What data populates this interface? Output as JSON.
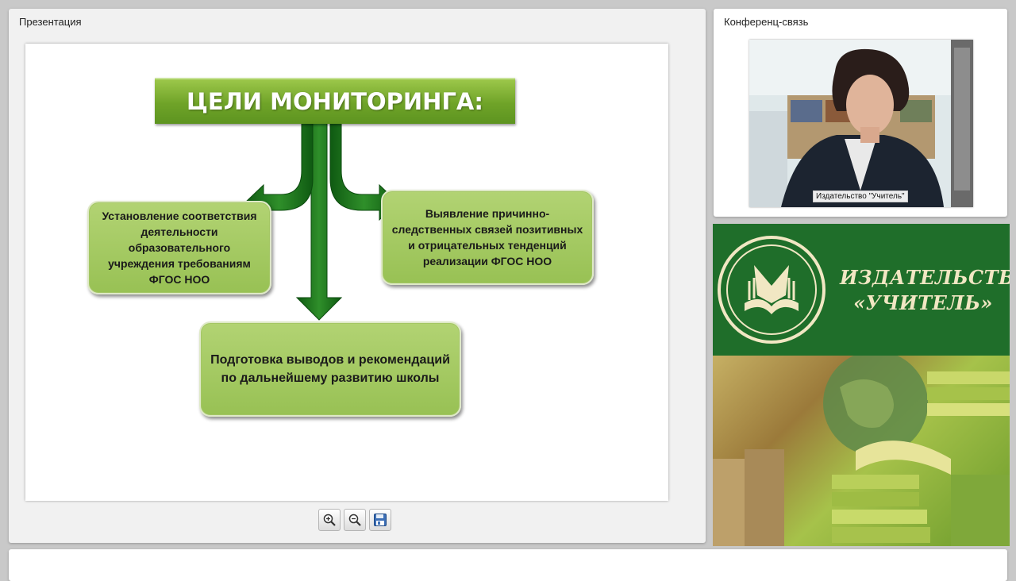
{
  "presentation": {
    "panel_title": "Презентация",
    "slide": {
      "heading": "ЦЕЛИ МОНИТОРИНГА:",
      "goals": [
        "Установление соответствия деятельности образовательного учреждения требованиям ФГОС НОО",
        "Выявление причинно-следственных связей позитивных и отрицательных тенденций реализации ФГОС НОО",
        "Подготовка выводов и рекомендаций по дальнейшему развитию школы"
      ]
    },
    "toolbar": {
      "zoom_in_icon": "zoom-in-icon",
      "zoom_out_icon": "zoom-out-icon",
      "save_icon": "floppy-disk-icon"
    }
  },
  "conference": {
    "panel_title": "Конференц-связь",
    "video_label": "Издательство \"Учитель\""
  },
  "brand": {
    "name_line1": "ИЗДАТЕЛЬСТВО",
    "name_line2": "«УЧИТЕЛЬ»"
  },
  "colors": {
    "banner_green": "#6fa328",
    "box_green": "#a4c765",
    "arrow_green": "#1f7a1f",
    "brand_green": "#1f6e2a",
    "brand_text": "#f1e7c3"
  }
}
